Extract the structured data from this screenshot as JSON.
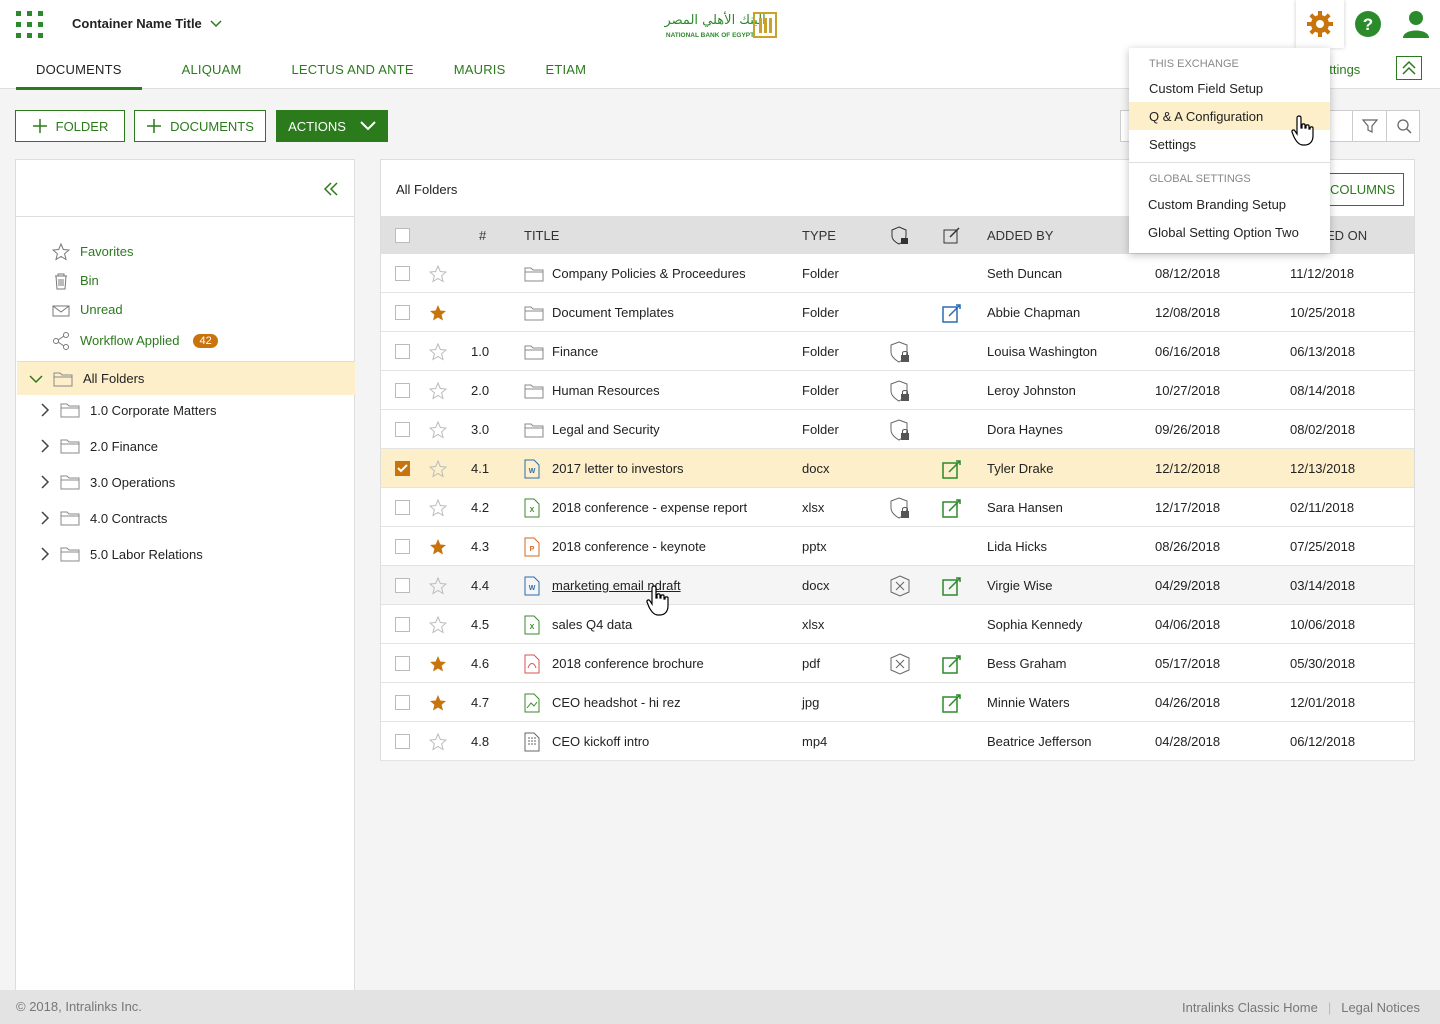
{
  "header": {
    "container_title": "Container Name Title",
    "logo_text_ar": "البنك الأهلي المصري",
    "logo_text_en": "NATIONAL BANK OF EGYPT",
    "tabs": [
      {
        "label": "DOCUMENTS",
        "active": true
      },
      {
        "label": "ALIQUAM"
      },
      {
        "label": "LECTUS AND ANTE"
      },
      {
        "label": "MAURIS"
      },
      {
        "label": "ETIAM"
      }
    ],
    "settings_link": "ettings",
    "icons": [
      "gear-icon",
      "help-icon",
      "user-icon"
    ]
  },
  "toolbar": {
    "folder_label": "FOLDER",
    "documents_label": "DOCUMENTS",
    "actions_label": "ACTIONS"
  },
  "sidebar": {
    "quick_links": [
      {
        "label": "Favorites",
        "icon": "star-icon"
      },
      {
        "label": "Bin",
        "icon": "trash-icon"
      },
      {
        "label": "Unread",
        "icon": "envelope-icon"
      },
      {
        "label": "Workflow Applied",
        "icon": "share-icon",
        "badge": "42"
      }
    ],
    "all_folders": "All Folders",
    "folders": [
      "1.0 Corporate Matters",
      "2.0 Finance",
      "3.0 Operations",
      "4.0 Contracts",
      "5.0 Labor Relations"
    ]
  },
  "main": {
    "heading": "All Folders",
    "columns_label": "COLUMNS",
    "headers": {
      "num": "#",
      "title": "TITLE",
      "type": "TYPE",
      "added_by": "ADDED BY",
      "modified_on": "ED ON"
    },
    "rows": [
      {
        "num": "",
        "title": "Company Policies & Proceedures",
        "type": "Folder",
        "icon": "folder",
        "added_by": "Seth Duncan",
        "date1": "08/12/2018",
        "date2": "11/12/2018",
        "star": false,
        "sec": "",
        "edit": false,
        "checked": false
      },
      {
        "num": "",
        "title": "Document Templates",
        "type": "Folder",
        "icon": "folder",
        "added_by": "Abbie Chapman",
        "date1": "12/08/2018",
        "date2": "10/25/2018",
        "star": true,
        "sec": "",
        "edit": true,
        "edit_style": "blue",
        "checked": false
      },
      {
        "num": "1.0",
        "title": "Finance",
        "type": "Folder",
        "icon": "folder",
        "added_by": "Louisa Washington",
        "date1": "06/16/2018",
        "date2": "06/13/2018",
        "star": false,
        "sec": "lock",
        "edit": false,
        "checked": false
      },
      {
        "num": "2.0",
        "title": "Human Resources",
        "type": "Folder",
        "icon": "folder",
        "added_by": "Leroy Johnston",
        "date1": "10/27/2018",
        "date2": "08/14/2018",
        "star": false,
        "sec": "lock",
        "edit": false,
        "checked": false
      },
      {
        "num": "3.0",
        "title": "Legal and Security",
        "type": "Folder",
        "icon": "folder",
        "added_by": "Dora Haynes",
        "date1": "09/26/2018",
        "date2": "08/02/2018",
        "star": false,
        "sec": "lock",
        "edit": false,
        "checked": false
      },
      {
        "num": "4.1",
        "title": "2017 letter to investors",
        "type": "docx",
        "icon": "word",
        "added_by": "Tyler Drake",
        "date1": "12/12/2018",
        "date2": "12/13/2018",
        "star": false,
        "sec": "",
        "edit": true,
        "checked": true
      },
      {
        "num": "4.2",
        "title": "2018 conference - expense report",
        "type": "xlsx",
        "icon": "excel",
        "added_by": "Sara Hansen",
        "date1": "12/17/2018",
        "date2": "02/11/2018",
        "star": false,
        "sec": "lock",
        "edit": true,
        "checked": false
      },
      {
        "num": "4.3",
        "title": "2018 conference - keynote",
        "type": "pptx",
        "icon": "ppt",
        "added_by": "Lida Hicks",
        "date1": "08/26/2018",
        "date2": "07/25/2018",
        "star": true,
        "sec": "",
        "edit": false,
        "checked": false
      },
      {
        "num": "4.4",
        "title": "marketing email ndraft",
        "type": "docx",
        "icon": "word",
        "added_by": "Virgie Wise",
        "date1": "04/29/2018",
        "date2": "03/14/2018",
        "star": false,
        "sec": "x",
        "edit": true,
        "checked": false,
        "hover": true
      },
      {
        "num": "4.5",
        "title": "sales Q4 data",
        "type": "xlsx",
        "icon": "excel",
        "added_by": "Sophia Kennedy",
        "date1": "04/06/2018",
        "date2": "10/06/2018",
        "star": false,
        "sec": "",
        "edit": false,
        "checked": false
      },
      {
        "num": "4.6",
        "title": "2018 conference brochure",
        "type": "pdf",
        "icon": "pdf",
        "added_by": "Bess Graham",
        "date1": "05/17/2018",
        "date2": "05/30/2018",
        "star": true,
        "sec": "x",
        "edit": true,
        "checked": false
      },
      {
        "num": "4.7",
        "title": "CEO headshot - hi rez",
        "type": "jpg",
        "icon": "image",
        "added_by": "Minnie Waters",
        "date1": "04/26/2018",
        "date2": "12/01/2018",
        "star": true,
        "sec": "",
        "edit": true,
        "checked": false
      },
      {
        "num": "4.8",
        "title": "CEO kickoff intro",
        "type": "mp4",
        "icon": "video",
        "added_by": "Beatrice Jefferson",
        "date1": "04/28/2018",
        "date2": "06/12/2018",
        "star": false,
        "sec": "",
        "edit": false,
        "checked": false
      }
    ]
  },
  "dropdown": {
    "section1": "THIS EXCHANGE",
    "items1": [
      "Custom Field Setup",
      "Q & A Configuration",
      "Settings"
    ],
    "highlighted": "Q & A Configuration",
    "section2": "GLOBAL SETTINGS",
    "items2": [
      "Custom Branding Setup",
      "Global Setting Option Two"
    ]
  },
  "footer": {
    "copyright": "© 2018, Intralinks Inc.",
    "link1": "Intralinks Classic Home",
    "separator": "|",
    "link2": "Legal Notices"
  },
  "colors": {
    "accent": "#2b7a1c",
    "star": "#c8730b",
    "selected_row": "#fdefc9",
    "gear": "#c8730b"
  }
}
